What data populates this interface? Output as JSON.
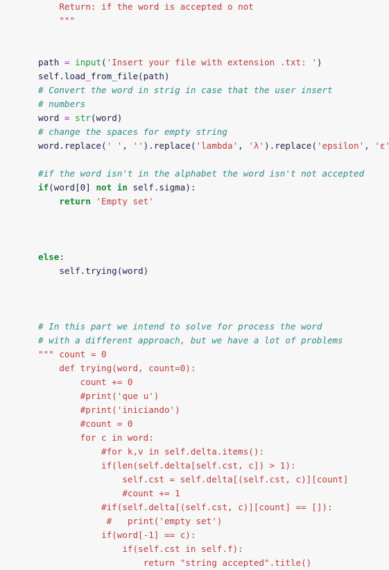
{
  "editor": {
    "language": "python",
    "background_color": "#f7f7f7",
    "colors": {
      "string": "#bd3b3b",
      "comment": "#2d8a8a",
      "keyword": "#128a2c",
      "builtin": "#149a3a",
      "operator": "#a726d6",
      "identifier": "#202050"
    }
  },
  "code": {
    "lines": [
      {
        "id": "l1",
        "indent": 4,
        "tokens": [
          {
            "t": "doc",
            "v": "Return: if the word is accepted o not"
          }
        ]
      },
      {
        "id": "l2",
        "indent": 4,
        "tokens": [
          {
            "t": "doc",
            "v": "\"\"\""
          }
        ]
      },
      {
        "id": "l3",
        "indent": 0,
        "tokens": []
      },
      {
        "id": "l4",
        "indent": 0,
        "tokens": []
      },
      {
        "id": "l5",
        "indent": 0,
        "tokens": [
          {
            "t": "name",
            "v": "path "
          },
          {
            "t": "op",
            "v": "="
          },
          {
            "t": "plain",
            "v": " "
          },
          {
            "t": "bi",
            "v": "input"
          },
          {
            "t": "plain",
            "v": "("
          },
          {
            "t": "str",
            "v": "'Insert your file with extension .txt: '"
          },
          {
            "t": "plain",
            "v": ")"
          }
        ]
      },
      {
        "id": "l6",
        "indent": 0,
        "tokens": [
          {
            "t": "plain",
            "v": "self.load_from_file(path)"
          }
        ]
      },
      {
        "id": "l7",
        "indent": 0,
        "tokens": [
          {
            "t": "com",
            "v": "# Convert the word in strig in case that the user insert"
          }
        ]
      },
      {
        "id": "l8",
        "indent": 0,
        "tokens": [
          {
            "t": "com",
            "v": "# numbers"
          }
        ]
      },
      {
        "id": "l9",
        "indent": 0,
        "tokens": [
          {
            "t": "name",
            "v": "word "
          },
          {
            "t": "op",
            "v": "="
          },
          {
            "t": "plain",
            "v": " "
          },
          {
            "t": "bi",
            "v": "str"
          },
          {
            "t": "plain",
            "v": "(word)"
          }
        ]
      },
      {
        "id": "l10",
        "indent": 0,
        "tokens": [
          {
            "t": "com",
            "v": "# change the spaces for empty string"
          }
        ]
      },
      {
        "id": "l11",
        "indent": 0,
        "tokens": [
          {
            "t": "plain",
            "v": "word.replace("
          },
          {
            "t": "str",
            "v": "' '"
          },
          {
            "t": "plain",
            "v": ", "
          },
          {
            "t": "str",
            "v": "''"
          },
          {
            "t": "plain",
            "v": ").replace("
          },
          {
            "t": "str",
            "v": "'lambda'"
          },
          {
            "t": "plain",
            "v": ", "
          },
          {
            "t": "str",
            "v": "'λ'"
          },
          {
            "t": "plain",
            "v": ").replace("
          },
          {
            "t": "str",
            "v": "'epsilon'"
          },
          {
            "t": "plain",
            "v": ", "
          },
          {
            "t": "str",
            "v": "'ε'"
          },
          {
            "t": "plain",
            "v": ")"
          }
        ]
      },
      {
        "id": "l12",
        "indent": 0,
        "tokens": []
      },
      {
        "id": "l13",
        "indent": 0,
        "tokens": [
          {
            "t": "com",
            "v": "#if the word isn't in the alphabet the word isn't not accepted"
          }
        ]
      },
      {
        "id": "l14",
        "indent": 0,
        "tokens": [
          {
            "t": "kw",
            "v": "if"
          },
          {
            "t": "plain",
            "v": "(word["
          },
          {
            "t": "plain",
            "v": "0"
          },
          {
            "t": "plain",
            "v": "] "
          },
          {
            "t": "kw",
            "v": "not in"
          },
          {
            "t": "plain",
            "v": " self.sigma):"
          }
        ]
      },
      {
        "id": "l15",
        "indent": 4,
        "tokens": [
          {
            "t": "kw",
            "v": "return"
          },
          {
            "t": "plain",
            "v": " "
          },
          {
            "t": "str",
            "v": "'Empty set'"
          }
        ]
      },
      {
        "id": "l16",
        "indent": 0,
        "tokens": []
      },
      {
        "id": "l17",
        "indent": 0,
        "tokens": []
      },
      {
        "id": "l18",
        "indent": 0,
        "tokens": []
      },
      {
        "id": "l19",
        "indent": 0,
        "tokens": [
          {
            "t": "kw",
            "v": "else"
          },
          {
            "t": "plain",
            "v": ":"
          }
        ]
      },
      {
        "id": "l20",
        "indent": 4,
        "tokens": [
          {
            "t": "plain",
            "v": "self.trying(word)"
          }
        ]
      },
      {
        "id": "l21",
        "indent": 0,
        "tokens": []
      },
      {
        "id": "l22",
        "indent": 0,
        "tokens": []
      },
      {
        "id": "l23",
        "indent": 0,
        "tokens": []
      },
      {
        "id": "l24",
        "indent": 0,
        "tokens": [
          {
            "t": "com",
            "v": "# In this part we intend to solve for process the word"
          }
        ]
      },
      {
        "id": "l25",
        "indent": 0,
        "tokens": [
          {
            "t": "com",
            "v": "# with a different approach, but we have a lot of problems"
          }
        ]
      },
      {
        "id": "l26",
        "indent": 0,
        "tokens": [
          {
            "t": "str",
            "v": "\"\"\" count = 0"
          }
        ]
      },
      {
        "id": "l27",
        "indent": 0,
        "tokens": [
          {
            "t": "str",
            "v": "    def trying(word, count=0):"
          }
        ]
      },
      {
        "id": "l28",
        "indent": 0,
        "tokens": [
          {
            "t": "str",
            "v": "        count += 0"
          }
        ]
      },
      {
        "id": "l29",
        "indent": 0,
        "tokens": [
          {
            "t": "str",
            "v": "        #print('que u')"
          }
        ]
      },
      {
        "id": "l30",
        "indent": 0,
        "tokens": [
          {
            "t": "str",
            "v": "        #print('iniciando')"
          }
        ]
      },
      {
        "id": "l31",
        "indent": 0,
        "tokens": [
          {
            "t": "str",
            "v": "        #count = 0"
          }
        ]
      },
      {
        "id": "l32",
        "indent": 0,
        "tokens": [
          {
            "t": "str",
            "v": "        for c in word:"
          }
        ]
      },
      {
        "id": "l33",
        "indent": 0,
        "tokens": [
          {
            "t": "str",
            "v": "            #for k,v in self.delta.items():"
          }
        ]
      },
      {
        "id": "l34",
        "indent": 0,
        "tokens": [
          {
            "t": "str",
            "v": "            if(len(self.delta[self.cst, c]) > 1):"
          }
        ]
      },
      {
        "id": "l35",
        "indent": 0,
        "tokens": [
          {
            "t": "str",
            "v": "                self.cst = self.delta[(self.cst, c)][count]"
          }
        ]
      },
      {
        "id": "l36",
        "indent": 0,
        "tokens": [
          {
            "t": "str",
            "v": "                #count += 1"
          }
        ]
      },
      {
        "id": "l37",
        "indent": 0,
        "tokens": [
          {
            "t": "str",
            "v": "            #if(self.delta[(self.cst, c)][count] == []):"
          }
        ]
      },
      {
        "id": "l38",
        "indent": 0,
        "tokens": [
          {
            "t": "str",
            "v": "             #   print('empty set')"
          }
        ]
      },
      {
        "id": "l39",
        "indent": 0,
        "tokens": [
          {
            "t": "str",
            "v": "            if(word[-1] == c):"
          }
        ]
      },
      {
        "id": "l40",
        "indent": 0,
        "tokens": [
          {
            "t": "str",
            "v": "                if(self.cst in self.f):"
          }
        ]
      },
      {
        "id": "l41",
        "indent": 0,
        "tokens": [
          {
            "t": "str",
            "v": "                    return \"string accepted\".title()"
          }
        ]
      }
    ]
  }
}
